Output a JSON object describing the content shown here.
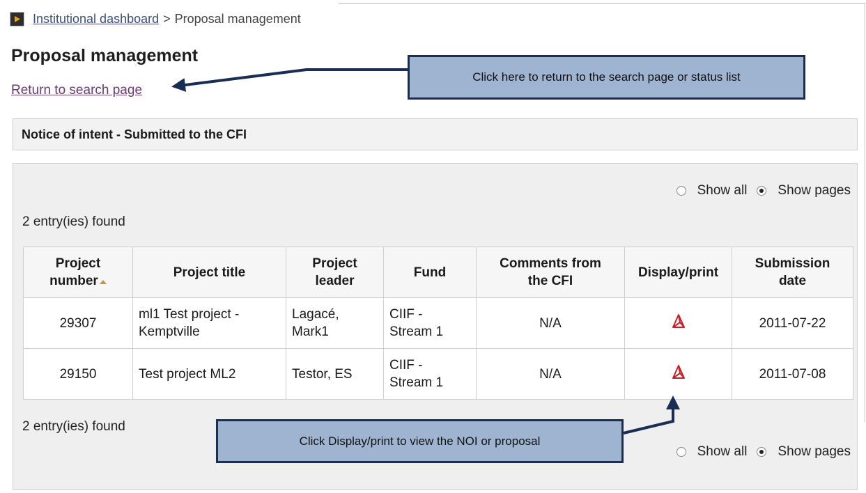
{
  "breadcrumb": {
    "dashboard_link": "Institutional dashboard",
    "separator": ">",
    "current": "Proposal management"
  },
  "page_title": "Proposal management",
  "return_link": "Return to search page",
  "callouts": {
    "return": "Click here to return to the search page or status list",
    "display": "Click Display/print to view the NOI or proposal"
  },
  "section_title": "Notice of intent - Submitted to the CFI",
  "show_options": {
    "all_label": "Show all",
    "pages_label": "Show pages",
    "selected": "pages"
  },
  "entries_found": "2 entry(ies) found",
  "table": {
    "headers": {
      "number_line1": "Project",
      "number_line2": "number",
      "title": "Project title",
      "leader_line1": "Project",
      "leader_line2": "leader",
      "fund": "Fund",
      "comments_line1": "Comments from",
      "comments_line2": "the CFI",
      "display": "Display/print",
      "date_line1": "Submission",
      "date_line2": "date"
    },
    "rows": [
      {
        "number": "29307",
        "title_line1": "ml1 Test project -",
        "title_line2": "Kemptville",
        "leader_line1": "Lagacé,",
        "leader_line2": "Mark1",
        "fund_line1": "CIIF -",
        "fund_line2": "Stream 1",
        "comments": "N/A",
        "date": "2011-07-22"
      },
      {
        "number": "29150",
        "title_line1": "Test project ML2",
        "title_line2": "",
        "leader_line1": "Testor, ES",
        "leader_line2": "",
        "fund_line1": "CIIF -",
        "fund_line2": "Stream 1",
        "comments": "N/A",
        "date": "2011-07-08"
      }
    ]
  },
  "colors": {
    "callout_fill": "#9fb4d1",
    "callout_border": "#1a2d52",
    "link_visited": "#6a3b70",
    "pdf_red": "#c8202a"
  },
  "icons": {
    "breadcrumb": "play-arrow-icon",
    "display": "pdf-icon",
    "sort": "sort-ascending-icon"
  }
}
